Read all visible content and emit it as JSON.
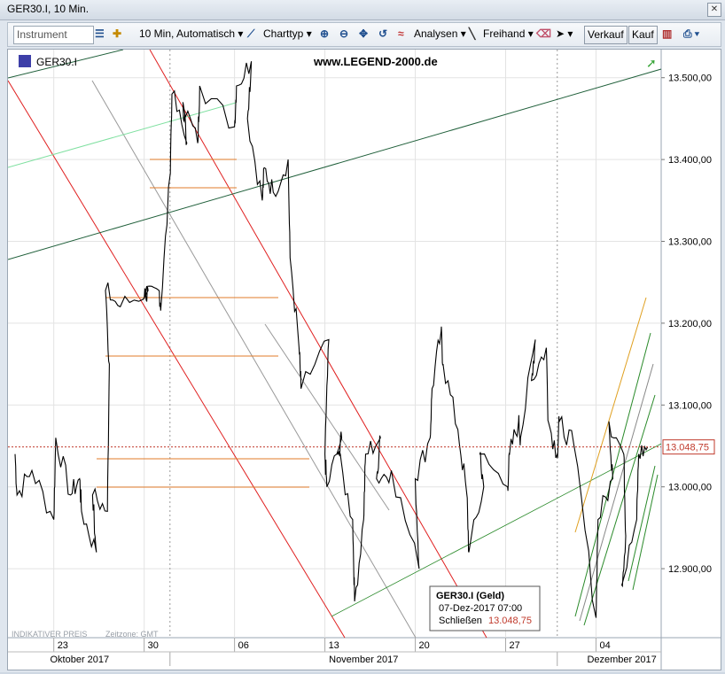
{
  "window": {
    "title": "GER30.I, 10 Min."
  },
  "toolbar": {
    "instrument_placeholder": "Instrument",
    "interval_label": "10 Min,  Automatisch",
    "charttyp_label": "Charttyp",
    "analysen_label": "Analysen",
    "freihand_label": "Freihand",
    "verkauf_label": "Verkauf",
    "kauf_label": "Kauf"
  },
  "chart_data": {
    "type": "line",
    "symbol_label": "GER30.I",
    "watermark": "www.LEGEND-2000.de",
    "footer_left": "INDIKATIVER PREIS",
    "footer_tz": "Zeitzone: GMT",
    "current_price_label": "13.048,75",
    "current_price": 13048.75,
    "ylim": [
      12820,
      13530
    ],
    "y_ticks": [
      12900,
      13000,
      13100,
      13200,
      13300,
      13400,
      13500
    ],
    "y_tick_labels": [
      "12.900,00",
      "13.000,00",
      "13.100,00",
      "13.200,00",
      "13.300,00",
      "13.400,00",
      "13.500,00"
    ],
    "x_day_ticks": [
      "23",
      "30",
      "06",
      "13",
      "20",
      "27",
      "04"
    ],
    "x_months": [
      "Oktober 2017",
      "November 2017",
      "Dezember 2017"
    ],
    "grid": true,
    "series": [
      {
        "points": [
          [
            "2017-10-20",
            13040
          ],
          [
            "2017-10-20",
            12990
          ],
          [
            "2017-10-21",
            13020
          ],
          [
            "2017-10-23",
            12960
          ],
          [
            "2017-10-23",
            13060
          ],
          [
            "2017-10-24",
            12990
          ],
          [
            "2017-10-25",
            13010
          ],
          [
            "2017-10-25",
            12970
          ],
          [
            "2017-10-26",
            12920
          ],
          [
            "2017-10-26",
            12990
          ],
          [
            "2017-10-27",
            12970
          ],
          [
            "2017-10-27",
            13150
          ],
          [
            "2017-10-27",
            13240
          ],
          [
            "2017-10-28",
            13220
          ],
          [
            "2017-10-30",
            13240
          ],
          [
            "2017-10-30",
            13230
          ],
          [
            "2017-10-31",
            13240
          ],
          [
            "2017-10-31",
            13220
          ],
          [
            "2017-11-01",
            13380
          ],
          [
            "2017-11-01",
            13480
          ],
          [
            "2017-11-02",
            13420
          ],
          [
            "2017-11-02",
            13470
          ],
          [
            "2017-11-03",
            13420
          ],
          [
            "2017-11-03",
            13490
          ],
          [
            "2017-11-06",
            13440
          ],
          [
            "2017-11-06",
            13490
          ],
          [
            "2017-11-07",
            13520
          ],
          [
            "2017-11-07",
            13450
          ],
          [
            "2017-11-08",
            13350
          ],
          [
            "2017-11-08",
            13390
          ],
          [
            "2017-11-09",
            13360
          ],
          [
            "2017-11-10",
            13400
          ],
          [
            "2017-11-10",
            13280
          ],
          [
            "2017-11-11",
            13170
          ],
          [
            "2017-11-11",
            13120
          ],
          [
            "2017-11-13",
            13180
          ],
          [
            "2017-11-13",
            13040
          ],
          [
            "2017-11-13",
            13000
          ],
          [
            "2017-11-14",
            13060
          ],
          [
            "2017-11-14",
            13040
          ],
          [
            "2017-11-15",
            12960
          ],
          [
            "2017-11-15",
            12860
          ],
          [
            "2017-11-16",
            12960
          ],
          [
            "2017-11-16",
            13040
          ],
          [
            "2017-11-17",
            13060
          ],
          [
            "2017-11-17",
            13010
          ],
          [
            "2017-11-18",
            13020
          ],
          [
            "2017-11-20",
            12900
          ],
          [
            "2017-11-20",
            13010
          ],
          [
            "2017-11-21",
            13060
          ],
          [
            "2017-11-21",
            13120
          ],
          [
            "2017-11-22",
            13190
          ],
          [
            "2017-11-22",
            13150
          ],
          [
            "2017-11-23",
            13070
          ],
          [
            "2017-11-24",
            12990
          ],
          [
            "2017-11-24",
            12920
          ],
          [
            "2017-11-25",
            13000
          ],
          [
            "2017-11-25",
            13040
          ],
          [
            "2017-11-27",
            13000
          ],
          [
            "2017-11-27",
            13040
          ],
          [
            "2017-11-28",
            13080
          ],
          [
            "2017-11-28",
            13060
          ],
          [
            "2017-11-29",
            13180
          ],
          [
            "2017-11-29",
            13130
          ],
          [
            "2017-11-30",
            13170
          ],
          [
            "2017-11-30",
            13080
          ],
          [
            "2017-12-01",
            13040
          ],
          [
            "2017-12-01",
            13080
          ],
          [
            "2017-12-02",
            13050
          ],
          [
            "2017-12-04",
            12840
          ],
          [
            "2017-12-04",
            12960
          ],
          [
            "2017-12-05",
            13010
          ],
          [
            "2017-12-05",
            13080
          ],
          [
            "2017-12-06",
            13040
          ],
          [
            "2017-12-06",
            12940
          ],
          [
            "2017-12-06",
            12880
          ],
          [
            "2017-12-07",
            12960
          ],
          [
            "2017-12-07",
            13040
          ],
          [
            "2017-12-08",
            13048.75
          ]
        ]
      }
    ],
    "tooltip": {
      "title": "GER30.I (Geld)",
      "datetime": "07-Dez-2017 07:00",
      "label": "Schließen",
      "value": "13.048,75"
    }
  }
}
